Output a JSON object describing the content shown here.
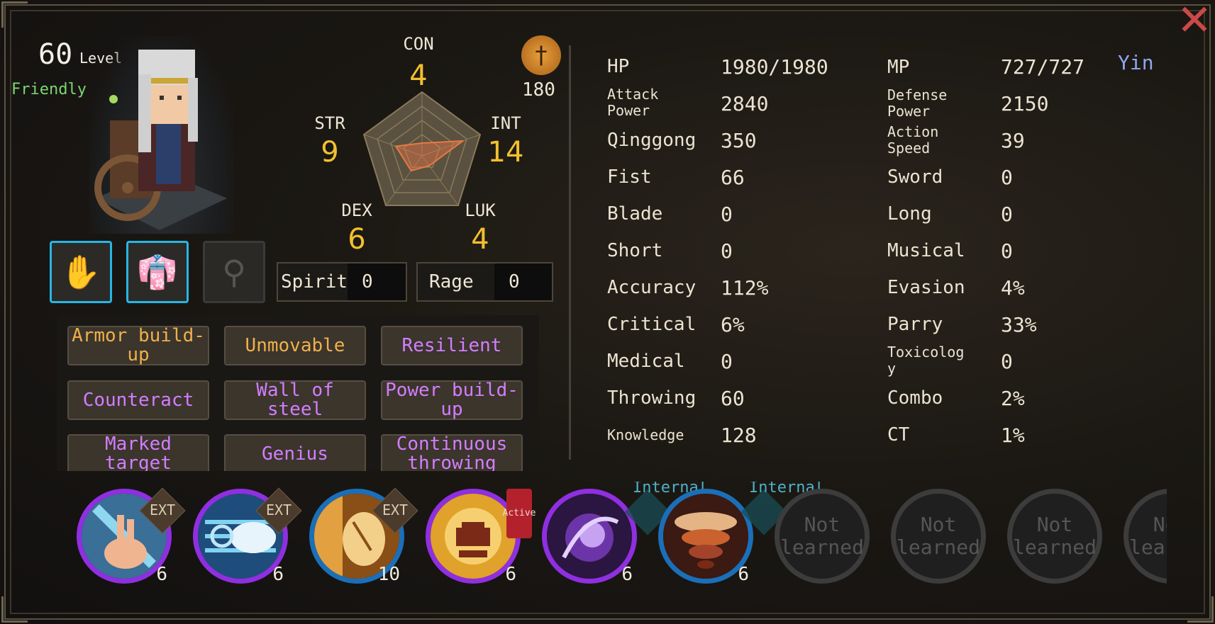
{
  "character": {
    "level": "60",
    "level_label": "Level",
    "relation": "Friendly"
  },
  "equipment": [
    {
      "icon": "gauntlet-icon"
    },
    {
      "icon": "robe-icon"
    },
    {
      "icon": "amulet-icon"
    }
  ],
  "attributes": {
    "con": {
      "label": "CON",
      "value": "4"
    },
    "str": {
      "label": "STR",
      "value": "9"
    },
    "int": {
      "label": "INT",
      "value": "14"
    },
    "dex": {
      "label": "DEX",
      "value": "6"
    },
    "luk": {
      "label": "LUK",
      "value": "4"
    }
  },
  "sect": {
    "icon": "sword-emblem-icon",
    "value": "180"
  },
  "resources": {
    "spirit": {
      "label": "Spirit",
      "value": "0"
    },
    "rage": {
      "label": "Rage",
      "value": "0"
    }
  },
  "traits": [
    {
      "label": "Armor build-up",
      "color": "#f0b04a"
    },
    {
      "label": "Unmovable",
      "color": "#f0b04a"
    },
    {
      "label": "Resilient",
      "color": "#d37dff"
    },
    {
      "label": "Counteract",
      "color": "#d37dff"
    },
    {
      "label": "Wall of steel",
      "color": "#d37dff"
    },
    {
      "label": "Power build-up",
      "color": "#d37dff"
    },
    {
      "label": "Marked target",
      "color": "#d37dff"
    },
    {
      "label": "Genius",
      "color": "#d37dff"
    },
    {
      "label": "Continuous throwing",
      "color": "#d37dff"
    }
  ],
  "stats_left": [
    {
      "label": "HP",
      "value": "1980/1980"
    },
    {
      "label": "Attack Power",
      "value": "2840"
    },
    {
      "label": "Qinggong",
      "value": "350"
    },
    {
      "label": "Fist",
      "value": "66"
    },
    {
      "label": "Blade",
      "value": "0"
    },
    {
      "label": "Short",
      "value": "0"
    },
    {
      "label": "Accuracy",
      "value": "112%"
    },
    {
      "label": "Critical",
      "value": "6%"
    },
    {
      "label": "Medical",
      "value": "0"
    },
    {
      "label": "Throwing",
      "value": "60"
    },
    {
      "label": "Knowledge",
      "value": "128"
    }
  ],
  "stats_right": [
    {
      "label": "MP",
      "value": "727/727"
    },
    {
      "label": "Defense Power",
      "value": "2150"
    },
    {
      "label": "Action Speed",
      "value": "39"
    },
    {
      "label": "Sword",
      "value": "0"
    },
    {
      "label": "Long",
      "value": "0"
    },
    {
      "label": "Musical",
      "value": "0"
    },
    {
      "label": "Evasion",
      "value": "4%"
    },
    {
      "label": "Parry",
      "value": "33%"
    },
    {
      "label": "Toxicology",
      "value": "0"
    },
    {
      "label": "Combo",
      "value": "2%"
    },
    {
      "label": "CT",
      "value": "1%"
    }
  ],
  "alignment": "Yin",
  "skills": [
    {
      "icon": "finger-strike-skill-icon",
      "level": "6",
      "tag": "EXT"
    },
    {
      "icon": "palm-wave-skill-icon",
      "level": "6",
      "tag": "EXT"
    },
    {
      "icon": "golden-hand-skill-icon",
      "level": "10",
      "tag": "EXT"
    },
    {
      "icon": "flame-demon-skill-icon",
      "level": "6",
      "tag": "Active"
    },
    {
      "icon": "purple-vortex-skill-icon",
      "level": "6",
      "tag": "Internal"
    },
    {
      "icon": "whirlwind-skill-icon",
      "level": "6",
      "tag": "Internal"
    },
    {
      "label": "Not learned"
    },
    {
      "label": "Not learned"
    },
    {
      "label": "Not learned"
    },
    {
      "label": "Not learned"
    }
  ],
  "pentagon": {
    "con": 4,
    "str": 9,
    "int": 14,
    "dex": 6,
    "luk": 4,
    "max": 20
  }
}
